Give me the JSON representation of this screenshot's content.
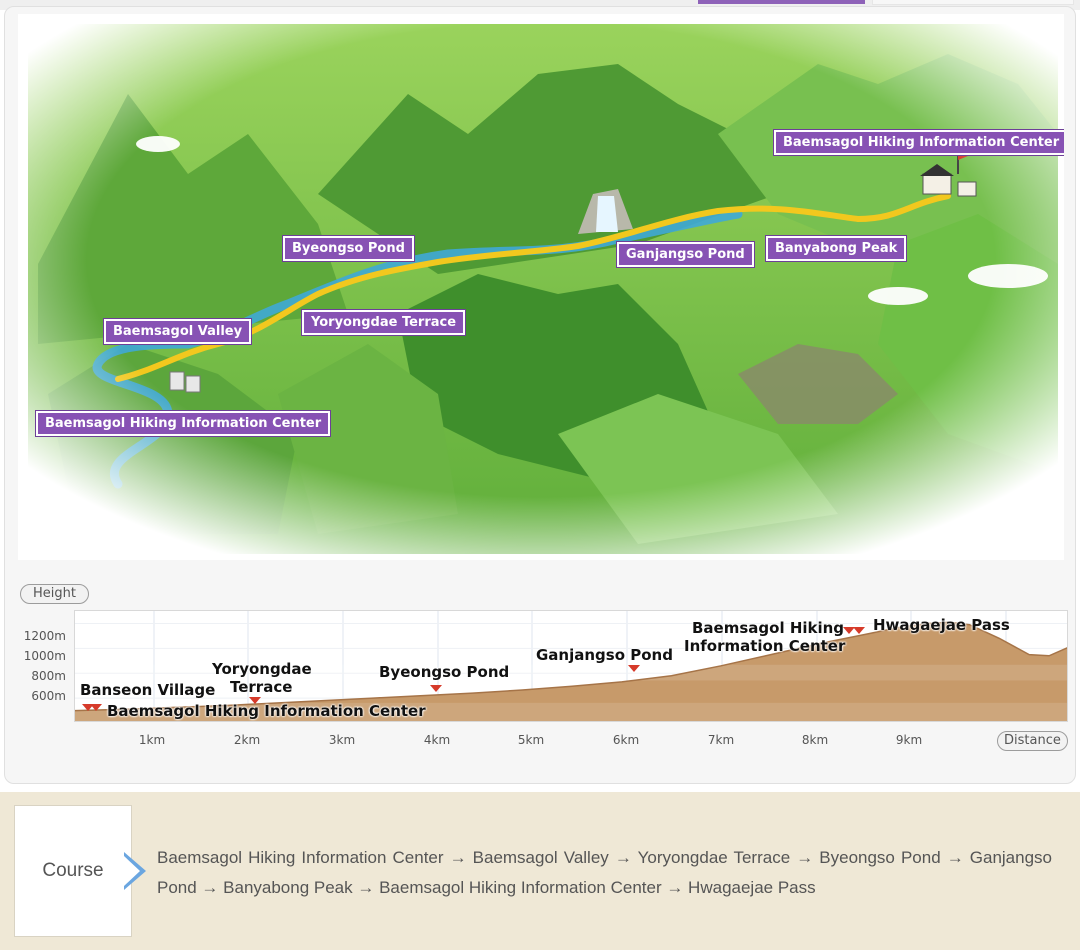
{
  "map": {
    "labels": {
      "hiking_center_east": "Baemsagol Hiking Information Center",
      "byeongso_pond": "Byeongso Pond",
      "ganjangso_pond": "Ganjangso Pond",
      "banyabong_peak": "Banyabong Peak",
      "yoryongdae_terrace": "Yoryongdae Terrace",
      "baemsagol_valley": "Baemsagol Valley",
      "hiking_center_west": "Baemsagol Hiking Information Center"
    },
    "colors": {
      "label_bg": "#8752b4",
      "trail": "#f2c81e",
      "stream": "#3fa8d6",
      "terrain": "#74c44a"
    }
  },
  "profile": {
    "y_axis_title": "Height",
    "x_axis_title": "Distance",
    "y_ticks": [
      "1200m",
      "1000m",
      "800m",
      "600m"
    ],
    "x_ticks": [
      "1km",
      "2km",
      "3km",
      "4km",
      "5km",
      "6km",
      "7km",
      "8km",
      "9km"
    ],
    "labels": {
      "banseon_village": "Banseon Village",
      "hiking_center_start": "Baemsagol Hiking Information Center",
      "yoryongdae_line1": "Yoryongdae",
      "yoryongdae_line2": "Terrace",
      "byeongso_pond": "Byeongso Pond",
      "ganjangso_pond": "Ganjangso Pond",
      "hiking_center_line1": "Baemsagol Hiking",
      "hiking_center_line2": "Information Center",
      "hwagaejae_pass": "Hwagaejae Pass"
    },
    "colors": {
      "fill": "#c79a6a",
      "fill_dark": "#a67448",
      "marker": "#d63a2a"
    }
  },
  "chart_data": {
    "type": "area",
    "xlabel": "Distance",
    "ylabel": "Height",
    "x_unit": "km",
    "y_unit": "m",
    "xlim": [
      0,
      10.0
    ],
    "ylim": [
      400,
      1300
    ],
    "grid": true,
    "x": [
      0.0,
      0.5,
      1.0,
      1.5,
      2.0,
      2.5,
      3.0,
      3.5,
      4.0,
      4.5,
      5.0,
      5.5,
      6.0,
      6.5,
      7.0,
      7.5,
      8.0,
      8.3,
      8.6,
      8.8,
      9.0,
      9.3,
      9.6,
      9.8,
      10.0
    ],
    "values": [
      500,
      510,
      525,
      540,
      560,
      580,
      600,
      620,
      640,
      665,
      695,
      730,
      780,
      860,
      950,
      1040,
      1120,
      1170,
      1200,
      1210,
      1190,
      1080,
      950,
      940,
      1010
    ],
    "points_of_interest": [
      {
        "name": "Banseon Village",
        "x": 0.1
      },
      {
        "name": "Baemsagol Hiking Information Center",
        "x": 0.3
      },
      {
        "name": "Yoryongdae Terrace",
        "x": 1.9
      },
      {
        "name": "Byeongso Pond",
        "x": 3.9
      },
      {
        "name": "Ganjangso Pond",
        "x": 5.9
      },
      {
        "name": "Baemsagol Hiking Information Center",
        "x": 8.3
      },
      {
        "name": "Hwagaejae Pass",
        "x": 8.5
      }
    ]
  },
  "course": {
    "title": "Course",
    "route_text": "Baemsagol Hiking Information Center → Baemsagol Valley → Yoryongdae Terrace → Byeongso Pond → Ganjangso Pond → Banyabong Peak → Baemsagol Hiking Information Center → Hwagaejae Pass"
  }
}
